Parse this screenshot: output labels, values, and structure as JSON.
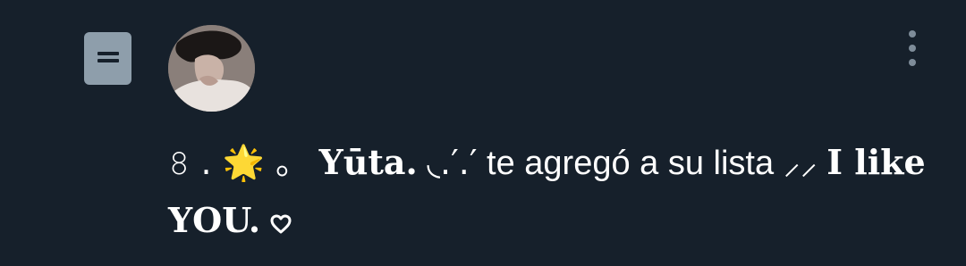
{
  "notification": {
    "icon": "list-icon",
    "actor_prefix": "𝟾 . 🌟 。",
    "actor_name": "Yūta.",
    "actor_suffix": "◟.′.′",
    "action_text": "te agregó a su lista",
    "list_prefix": "⸝⸝",
    "list_name": "I like YOU.",
    "list_suffix_icon": "heart-outline-icon",
    "more_icon": "more-vertical-icon",
    "avatar": "user-avatar"
  },
  "colors": {
    "background": "#16202b",
    "icon_bg": "#8e9eab",
    "text": "#ffffff",
    "muted": "#7e8c99"
  }
}
